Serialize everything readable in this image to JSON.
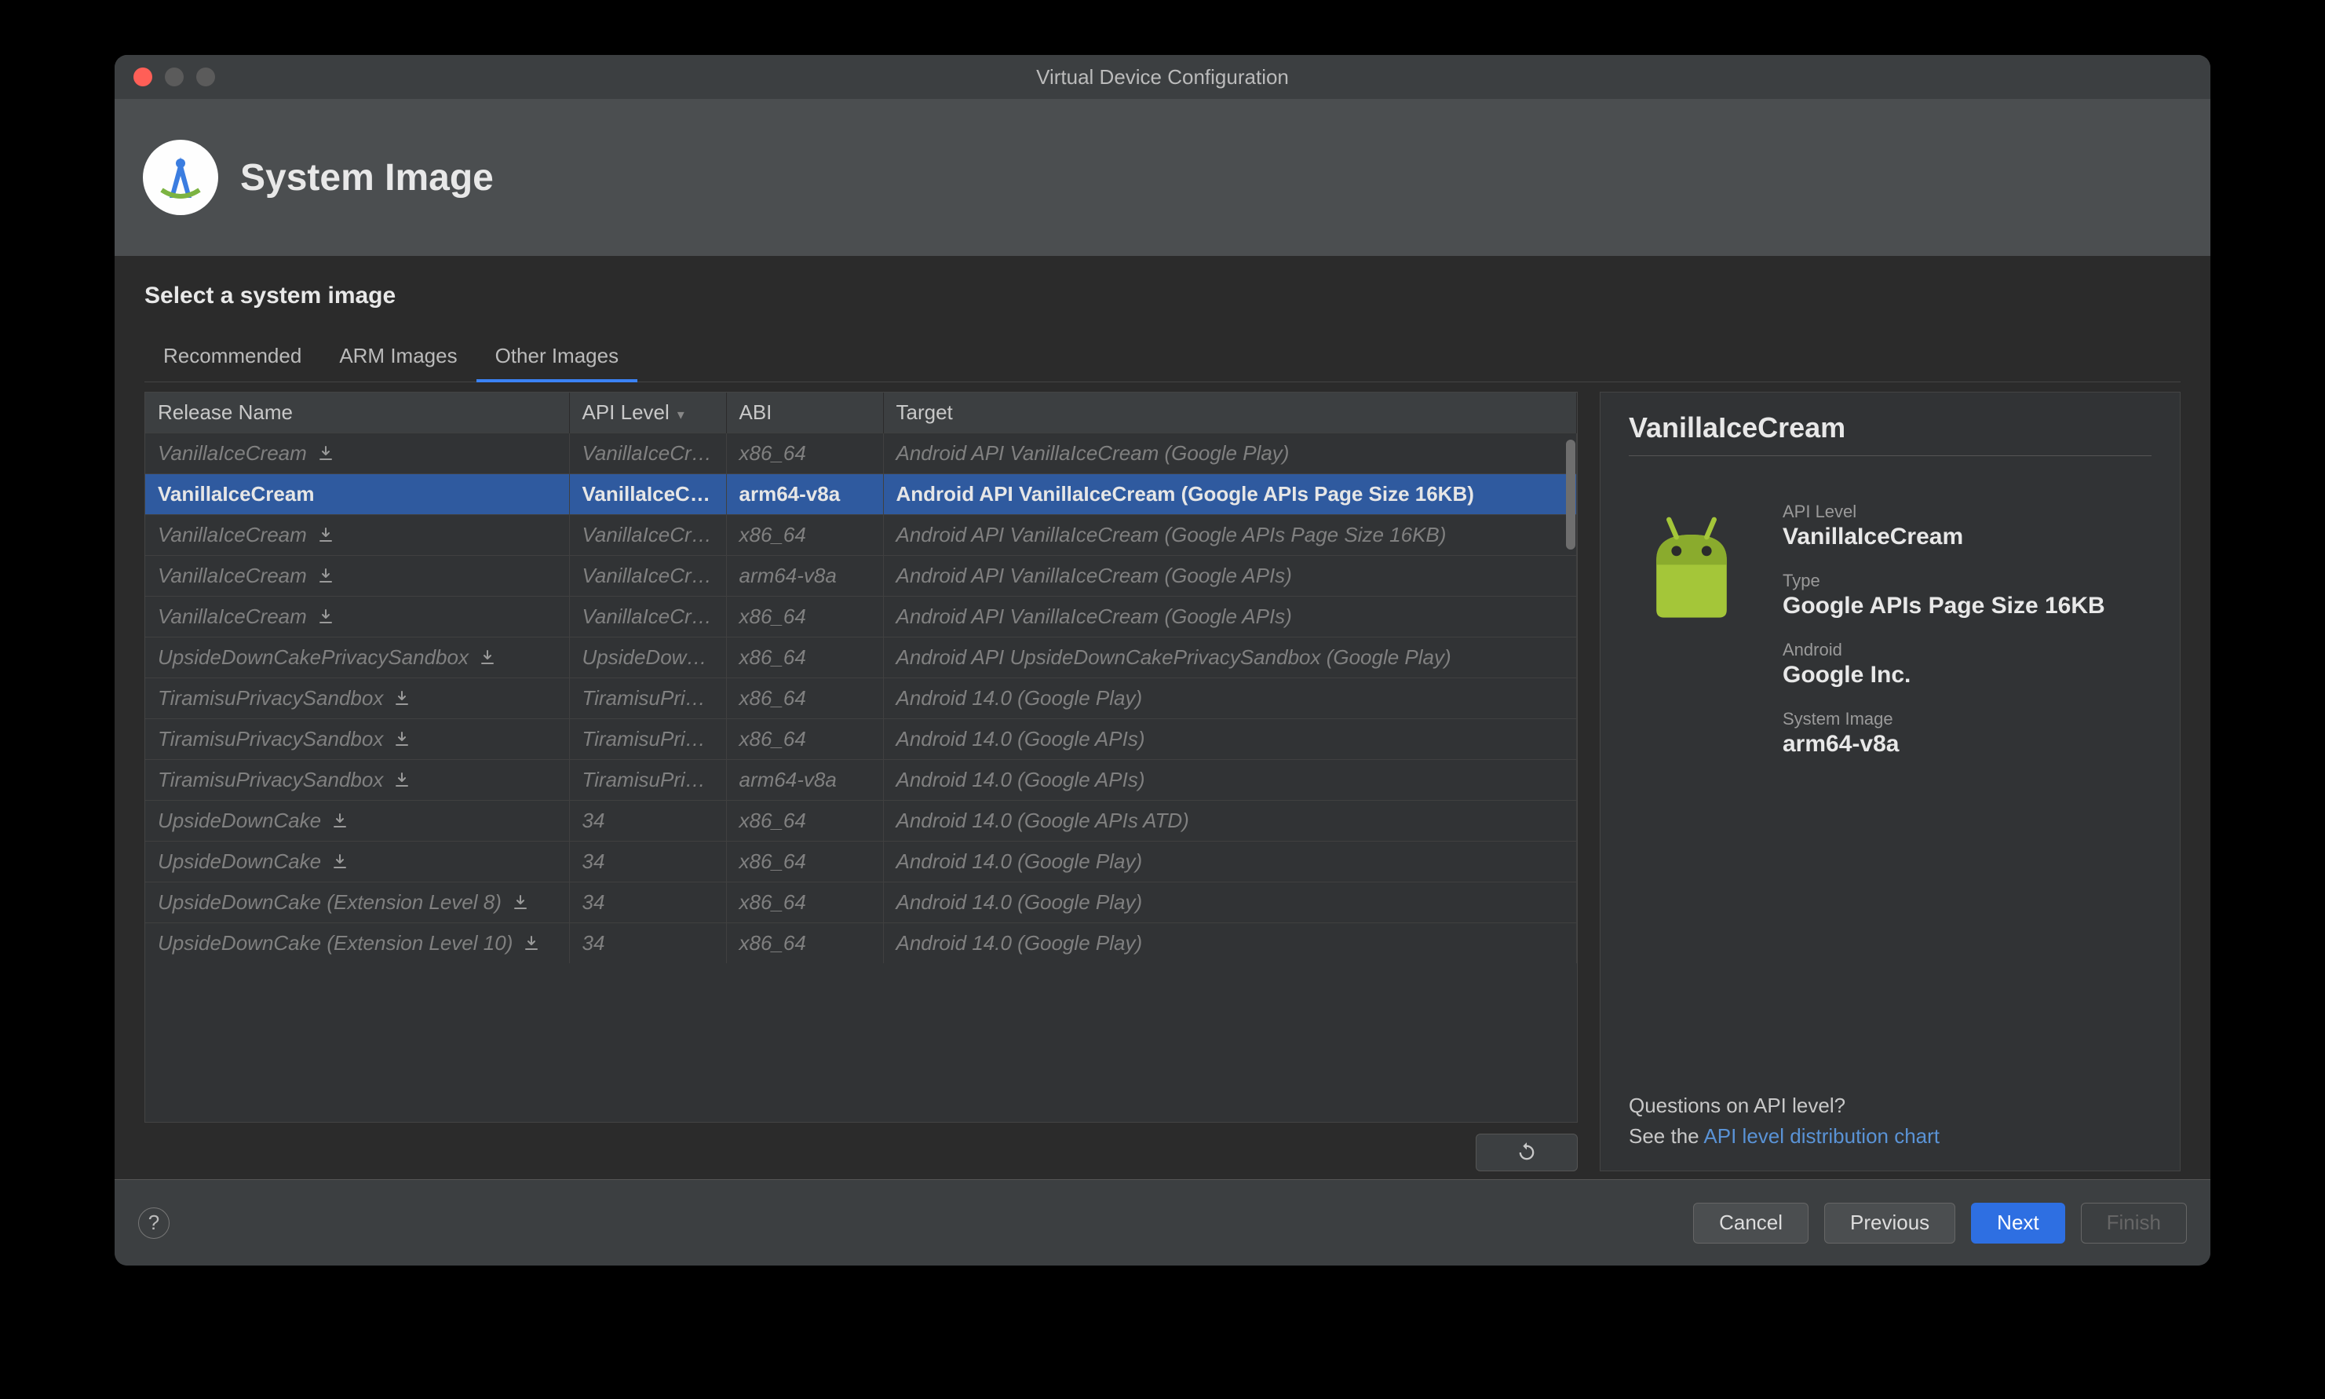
{
  "window": {
    "title": "Virtual Device Configuration"
  },
  "header": {
    "title": "System Image"
  },
  "section": {
    "title": "Select a system image"
  },
  "tabs": [
    {
      "label": "Recommended",
      "active": false
    },
    {
      "label": "ARM Images",
      "active": false
    },
    {
      "label": "Other Images",
      "active": true
    }
  ],
  "columns": {
    "release_name": "Release Name",
    "api_level": "API Level",
    "abi": "ABI",
    "target": "Target"
  },
  "rows": [
    {
      "name": "VanillaIceCream",
      "download": true,
      "api": "VanillaIceCream",
      "abi": "x86_64",
      "target": "Android API VanillaIceCream (Google Play)",
      "selected": false
    },
    {
      "name": "VanillaIceCream",
      "download": false,
      "api": "VanillaIceCream",
      "abi": "arm64-v8a",
      "target": "Android API VanillaIceCream (Google APIs Page Size 16KB)",
      "selected": true
    },
    {
      "name": "VanillaIceCream",
      "download": true,
      "api": "VanillaIceCream",
      "abi": "x86_64",
      "target": "Android API VanillaIceCream (Google APIs Page Size 16KB)",
      "selected": false
    },
    {
      "name": "VanillaIceCream",
      "download": true,
      "api": "VanillaIceCream",
      "abi": "arm64-v8a",
      "target": "Android API VanillaIceCream (Google APIs)",
      "selected": false
    },
    {
      "name": "VanillaIceCream",
      "download": true,
      "api": "VanillaIceCream",
      "abi": "x86_64",
      "target": "Android API VanillaIceCream (Google APIs)",
      "selected": false
    },
    {
      "name": "UpsideDownCakePrivacySandbox",
      "download": true,
      "api": "UpsideDownCak",
      "abi": "x86_64",
      "target": "Android API UpsideDownCakePrivacySandbox (Google Play)",
      "selected": false
    },
    {
      "name": "TiramisuPrivacySandbox",
      "download": true,
      "api": "TiramisuPrivacyS",
      "abi": "x86_64",
      "target": "Android 14.0 (Google Play)",
      "selected": false
    },
    {
      "name": "TiramisuPrivacySandbox",
      "download": true,
      "api": "TiramisuPrivacyS",
      "abi": "x86_64",
      "target": "Android 14.0 (Google APIs)",
      "selected": false
    },
    {
      "name": "TiramisuPrivacySandbox",
      "download": true,
      "api": "TiramisuPrivacyS",
      "abi": "arm64-v8a",
      "target": "Android 14.0 (Google APIs)",
      "selected": false
    },
    {
      "name": "UpsideDownCake",
      "download": true,
      "api": "34",
      "abi": "x86_64",
      "target": "Android 14.0 (Google APIs ATD)",
      "selected": false
    },
    {
      "name": "UpsideDownCake",
      "download": true,
      "api": "34",
      "abi": "x86_64",
      "target": "Android 14.0 (Google Play)",
      "selected": false
    },
    {
      "name": "UpsideDownCake (Extension Level 8)",
      "download": true,
      "api": "34",
      "abi": "x86_64",
      "target": "Android 14.0 (Google Play)",
      "selected": false
    },
    {
      "name": "UpsideDownCake (Extension Level 10)",
      "download": true,
      "api": "34",
      "abi": "x86_64",
      "target": "Android 14.0 (Google Play)",
      "selected": false
    }
  ],
  "detail": {
    "title": "VanillaIceCream",
    "api_level_label": "API Level",
    "api_level_value": "VanillaIceCream",
    "type_label": "Type",
    "type_value": "Google APIs Page Size 16KB",
    "android_label": "Android",
    "android_value": "Google Inc.",
    "system_image_label": "System Image",
    "system_image_value": "arm64-v8a",
    "questions": "Questions on API level?",
    "see_the": "See the ",
    "link": "API level distribution chart"
  },
  "footer": {
    "cancel": "Cancel",
    "previous": "Previous",
    "next": "Next",
    "finish": "Finish"
  }
}
